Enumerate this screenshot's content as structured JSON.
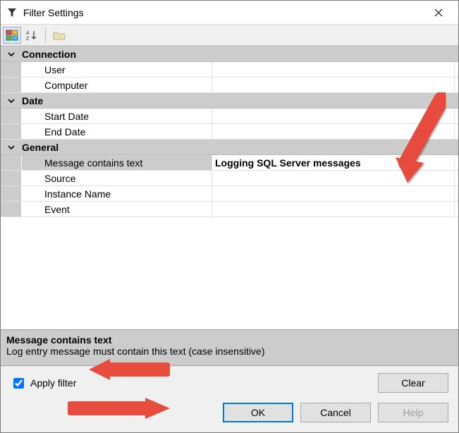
{
  "window": {
    "title": "Filter Settings"
  },
  "toolbar": {
    "categorized_tip": "Categorized",
    "alphabetical_tip": "Alphabetical",
    "folder_tip": "Property Pages"
  },
  "grid": {
    "cat_connection": "Connection",
    "user": {
      "label": "User",
      "value": ""
    },
    "computer": {
      "label": "Computer",
      "value": ""
    },
    "cat_date": "Date",
    "start_date": {
      "label": "Start Date",
      "value": ""
    },
    "end_date": {
      "label": "End Date",
      "value": ""
    },
    "cat_general": "General",
    "message_contains": {
      "label": "Message contains text",
      "value": "Logging SQL Server messages"
    },
    "source": {
      "label": "Source",
      "value": ""
    },
    "instance_name": {
      "label": "Instance Name",
      "value": ""
    },
    "event": {
      "label": "Event",
      "value": ""
    }
  },
  "description": {
    "title": "Message contains text",
    "text": "Log entry message must contain this text (case insensitive)"
  },
  "footer": {
    "apply_filter_label": "Apply filter",
    "apply_filter_checked": true,
    "clear_label": "Clear",
    "ok_label": "OK",
    "cancel_label": "Cancel",
    "help_label": "Help"
  }
}
